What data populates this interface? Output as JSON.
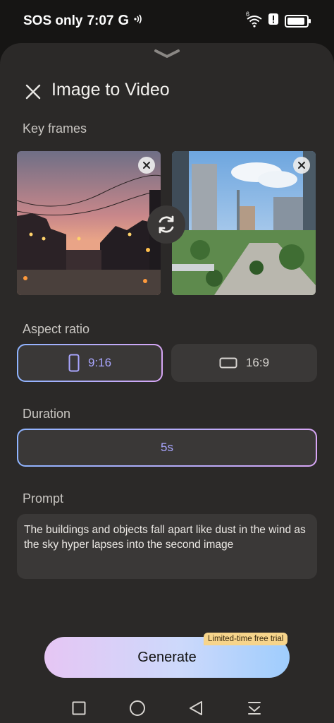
{
  "status_bar": {
    "carrier": "SOS only",
    "time": "7:07",
    "google_icon": "G",
    "hotspot_icon": "nfc-waves-icon",
    "wifi_label": "6",
    "alert_icon": "alert-icon",
    "battery_icon": "battery-icon"
  },
  "sheet": {
    "handle_icon": "chevron-down-icon",
    "close_icon": "close-icon",
    "title": "Image to Video"
  },
  "key_frames": {
    "label": "Key frames",
    "frame_1": {
      "description_icon": "sunset-street-photo",
      "remove_icon": "close-icon"
    },
    "frame_2": {
      "description_icon": "city-skyline-photo",
      "remove_icon": "close-icon"
    },
    "swap_icon": "swap-icon"
  },
  "aspect_ratio": {
    "label": "Aspect ratio",
    "options": [
      {
        "label": "9:16",
        "icon": "portrait-icon",
        "selected": true
      },
      {
        "label": "16:9",
        "icon": "landscape-icon",
        "selected": false
      }
    ]
  },
  "duration": {
    "label": "Duration",
    "value": "5s"
  },
  "prompt": {
    "label": "Prompt",
    "text": "The buildings and objects fall apart like dust in the wind as the sky hyper lapses into the second image"
  },
  "generate": {
    "label": "Generate",
    "badge": "Limited-time free trial"
  },
  "nav_bar": {
    "items": [
      "recents-icon",
      "home-icon",
      "back-icon",
      "notification-pull-icon"
    ]
  },
  "colors": {
    "accent_gradient_start": "#8fb4ff",
    "accent_gradient_end": "#d7a6f5",
    "selected_text": "#a9a6ff",
    "sheet_background": "#2b2928",
    "badge_background": "#f6d48b"
  }
}
